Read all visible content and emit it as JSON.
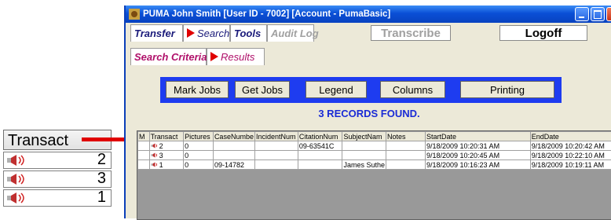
{
  "callout": {
    "header": "Transact",
    "rows": [
      "2",
      "3",
      "1"
    ]
  },
  "window": {
    "title": "PUMA  John Smith [User ID - 7002] [Account - PumaBasic]",
    "menu": {
      "transfer": "Transfer",
      "search": "Search",
      "tools": "Tools",
      "audit_log": "Audit Log",
      "transcribe": "Transcribe",
      "logoff": "Logoff"
    },
    "subtabs": {
      "search_criteria": "Search Criteria",
      "results": "Results"
    },
    "toolbar": {
      "mark_jobs": "Mark Jobs",
      "get_jobs": "Get Jobs",
      "legend": "Legend",
      "columns": "Columns",
      "printing": "Printing"
    },
    "records_found": "3 RECORDS FOUND.",
    "table": {
      "headers": [
        "M",
        "Transact",
        "Pictures",
        "CaseNumbe",
        "IncidentNum",
        "CitationNum",
        "SubjectNam",
        "Notes",
        "StartDate",
        "EndDate"
      ],
      "rows": [
        [
          "",
          "2",
          "0",
          "",
          "",
          "09-63541C",
          "",
          "",
          "9/18/2009 10:20:31 AM",
          "9/18/2009 10:20:42 AM"
        ],
        [
          "",
          "3",
          "0",
          "",
          "",
          "",
          "",
          "",
          "9/18/2009 10:20:45 AM",
          "9/18/2009 10:22:10 AM"
        ],
        [
          "",
          "1",
          "0",
          "09-14782",
          "",
          "",
          "James Suthe",
          "",
          "9/18/2009 10:16:23 AM",
          "9/18/2009 10:19:11 AM"
        ]
      ]
    }
  },
  "colors": {
    "titlebar": "#0a4fd6",
    "toolbar": "#1e3cf0",
    "records_text": "#1a2bd6",
    "arrow": "#e00000"
  }
}
